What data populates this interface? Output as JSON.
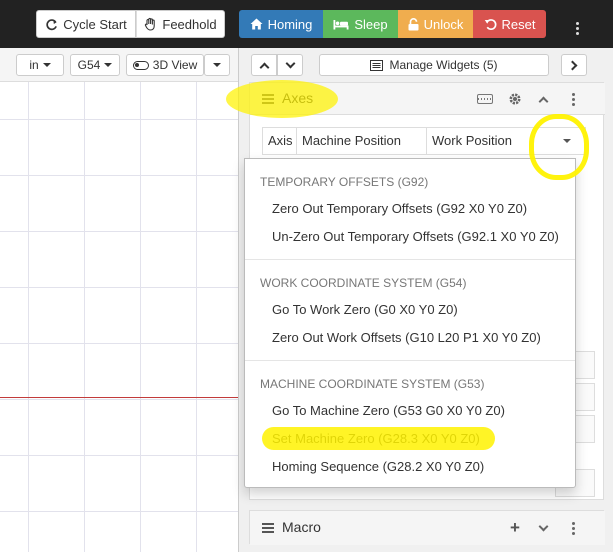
{
  "toolbar": {
    "cycle_start": "Cycle Start",
    "feedhold": "Feedhold",
    "homing": "Homing",
    "sleep": "Sleep",
    "unlock": "Unlock",
    "reset": "Reset"
  },
  "visualizer": {
    "units": "in",
    "wcs": "G54",
    "view": "3D View"
  },
  "panel": {
    "manage_widgets": "Manage Widgets (5)"
  },
  "axes_widget": {
    "title": "Axes",
    "columns": {
      "axis": "Axis",
      "machine_position": "Machine Position",
      "work_position": "Work Position"
    }
  },
  "dropdown": {
    "sections": [
      {
        "header": "TEMPORARY OFFSETS (G92)",
        "items": [
          "Zero Out Temporary Offsets (G92 X0 Y0 Z0)",
          "Un-Zero Out Temporary Offsets (G92.1 X0 Y0 Z0)"
        ]
      },
      {
        "header": "WORK COORDINATE SYSTEM (G54)",
        "items": [
          "Go To Work Zero (G0 X0 Y0 Z0)",
          "Zero Out Work Offsets (G10 L20 P1 X0 Y0 Z0)"
        ]
      },
      {
        "header": "MACHINE COORDINATE SYSTEM (G53)",
        "items": [
          "Go To Machine Zero (G53 G0 X0 Y0 Z0)",
          "Set Machine Zero (G28.3 X0 Y0 Z0)",
          "Homing Sequence (G28.2 X0 Y0 Z0)"
        ]
      }
    ]
  },
  "macro_widget": {
    "title": "Macro"
  },
  "colors": {
    "homing": "#337ab7",
    "sleep": "#5cb85c",
    "unlock": "#f0ad4e",
    "reset": "#d9534f",
    "highlight": "#fff200"
  }
}
